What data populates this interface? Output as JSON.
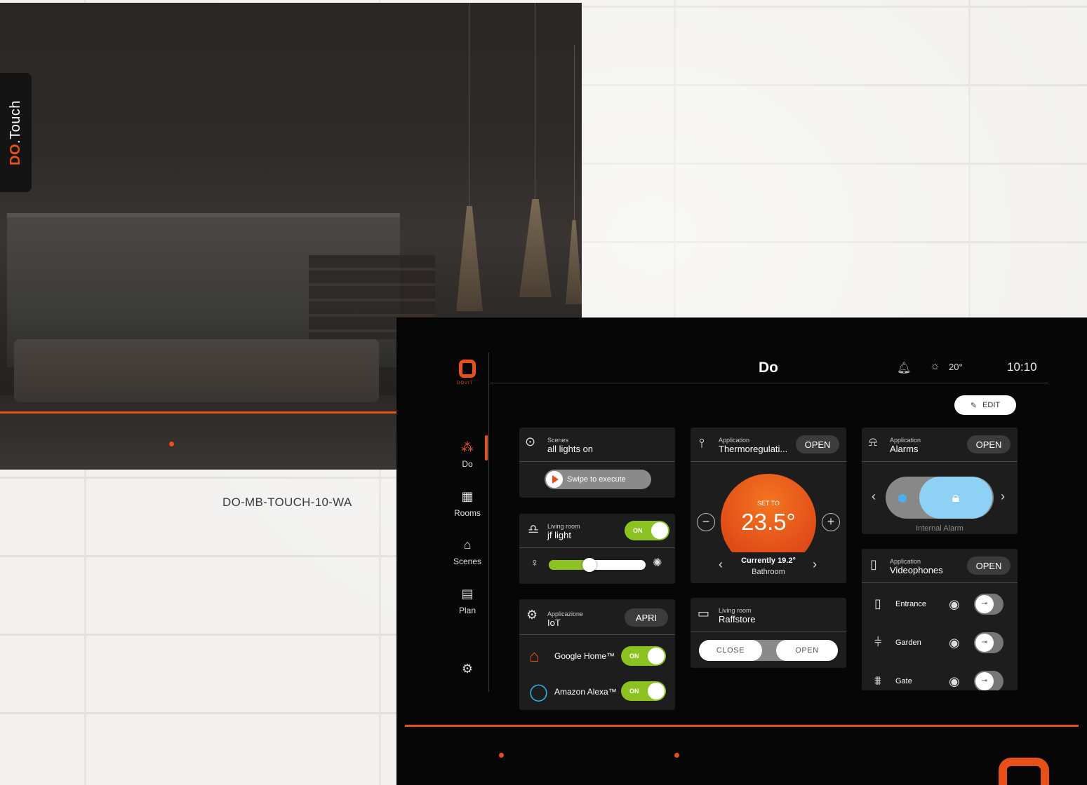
{
  "rear": {
    "brand": ".Touch",
    "brand_prefix": "DO",
    "model": "DO-MB-TOUCH-10-WA"
  },
  "app": {
    "logo_text": "DOVIT",
    "title": "Do",
    "weather_temp": "20°",
    "time": "10:10",
    "edit_label": "EDIT"
  },
  "sidebar": {
    "items": [
      {
        "label": "Do",
        "icon": "grid-icon",
        "active": true
      },
      {
        "label": "Rooms",
        "icon": "rooms-icon",
        "active": false
      },
      {
        "label": "Scenes",
        "icon": "scenes-icon",
        "active": false
      },
      {
        "label": "Plan",
        "icon": "calendar-icon",
        "active": false
      }
    ],
    "settings_icon": "gear-icon"
  },
  "cards": {
    "scenes": {
      "kicker": "Scenes",
      "title": "all lights on",
      "swipe": "Swipe to execute"
    },
    "light": {
      "kicker": "Living room",
      "title": "jf light",
      "toggle": "ON",
      "level": 0.35
    },
    "iot": {
      "kicker": "Applicazione",
      "title": "IoT",
      "button": "APRI",
      "items": [
        {
          "name": "Google Home™",
          "toggle": "ON"
        },
        {
          "name": "Amazon Alexa™",
          "toggle": "ON"
        }
      ]
    },
    "thermo": {
      "kicker": "Application",
      "title": "Thermoregulati...",
      "button": "OPEN",
      "set_label": "SET TO",
      "set_value": "23.5°",
      "current": "Currently 19.2°",
      "room": "Bathroom"
    },
    "raffstore": {
      "kicker": "Living room",
      "title": "Raffstore",
      "close": "CLOSE",
      "open": "OPEN"
    },
    "alarms": {
      "kicker": "Application",
      "title": "Alarms",
      "button": "OPEN",
      "label": "Internal Alarm"
    },
    "videophones": {
      "kicker": "Application",
      "title": "Videophones",
      "button": "OPEN",
      "items": [
        {
          "name": "Entrance"
        },
        {
          "name": "Garden"
        },
        {
          "name": "Gate"
        }
      ]
    }
  },
  "colors": {
    "accent": "#e8501a",
    "toggle_on": "#8cc21f",
    "alarm": "#8fd1f5"
  }
}
